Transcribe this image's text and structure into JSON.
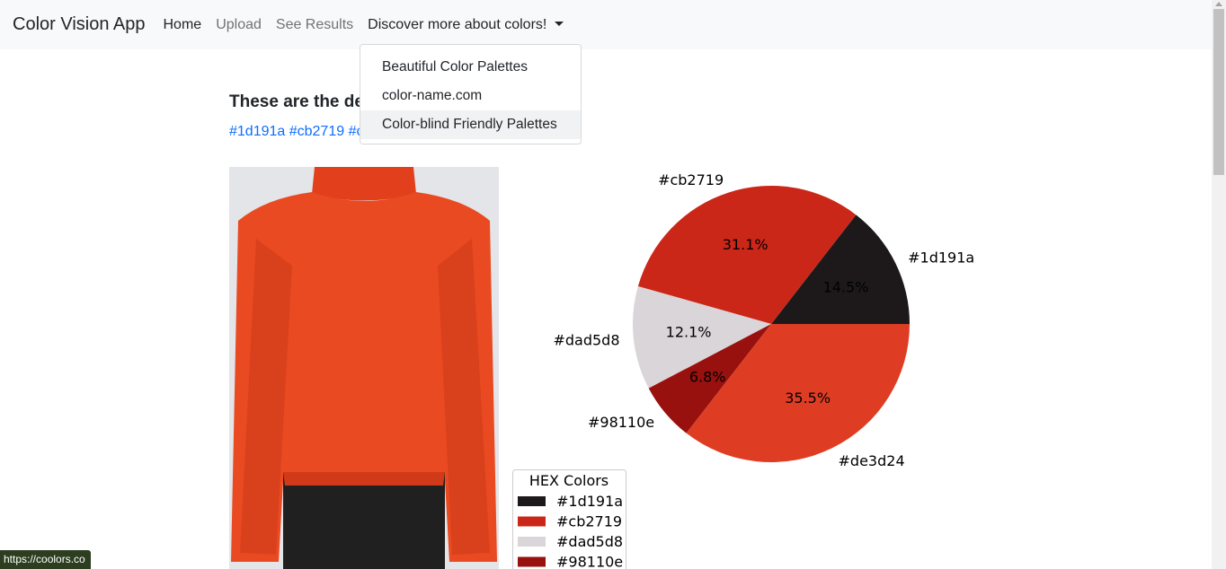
{
  "navbar": {
    "brand": "Color Vision App",
    "links": [
      "Home",
      "Upload",
      "See Results"
    ],
    "dropdown_label": "Discover more about colors!"
  },
  "dropdown": {
    "items": [
      "Beautiful Color Palettes",
      "color-name.com",
      "Color-blind Friendly Palettes"
    ]
  },
  "content": {
    "heading": "These are the de",
    "hex_links": "#1d191a #cb2719 #c"
  },
  "status_bar": {
    "url": "https://coolors.co"
  },
  "chart_data": {
    "type": "pie",
    "categories": [
      "#1d191a",
      "#cb2719",
      "#dad5d8",
      "#98110e",
      "#de3d24"
    ],
    "values": [
      14.5,
      31.1,
      12.1,
      6.8,
      35.5
    ],
    "value_labels": [
      "14.5%",
      "31.1%",
      "12.1%",
      "6.8%",
      "35.5%"
    ],
    "colors": [
      "#1d191a",
      "#cb2719",
      "#dad5d8",
      "#98110e",
      "#de3d24"
    ],
    "legend": {
      "title": "HEX Colors",
      "entries": [
        "#1d191a",
        "#cb2719",
        "#dad5d8",
        "#98110e"
      ]
    }
  }
}
